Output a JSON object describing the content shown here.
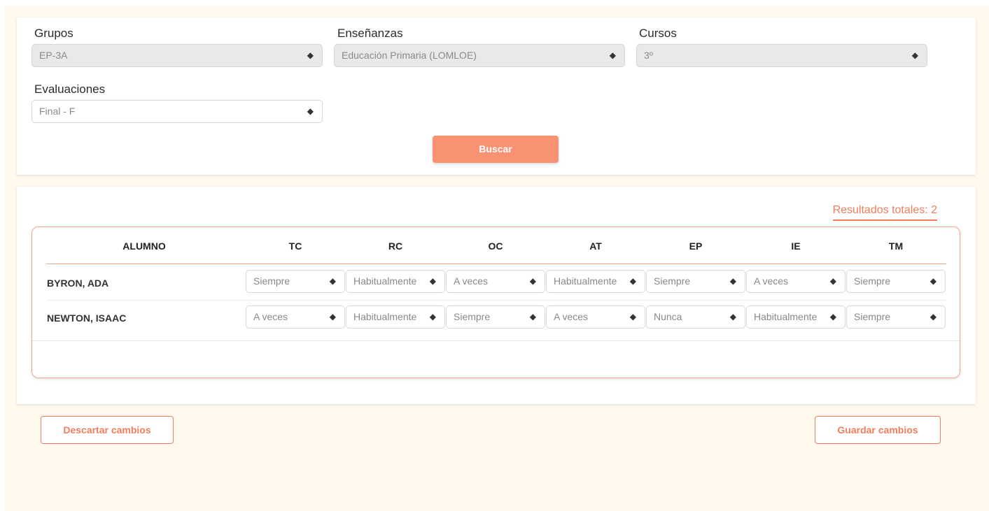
{
  "filters": {
    "grupos": {
      "label": "Grupos",
      "value": "EP-3A"
    },
    "ensenanzas": {
      "label": "Enseñanzas",
      "value": "Educación Primaria (LOMLOE)"
    },
    "cursos": {
      "label": "Cursos",
      "value": "3º"
    },
    "evaluaciones": {
      "label": "Evaluaciones",
      "value": "Final - F"
    },
    "search_label": "Buscar"
  },
  "results": {
    "total_label": "Resultados totales: 2",
    "columns": [
      "ALUMNO",
      "TC",
      "RC",
      "OC",
      "AT",
      "EP",
      "IE",
      "TM"
    ],
    "rows": [
      {
        "name": "BYRON, ADA",
        "values": [
          "Siempre",
          "Habitualmente",
          "A veces",
          "Habitualmente",
          "Siempre",
          "A veces",
          "Siempre"
        ]
      },
      {
        "name": "NEWTON, ISAAC",
        "values": [
          "A veces",
          "Habitualmente",
          "Siempre",
          "A veces",
          "Nunca",
          "Habitualmente",
          "Siempre"
        ]
      }
    ]
  },
  "actions": {
    "discard_label": "Descartar cambios",
    "save_label": "Guardar cambios"
  },
  "icons": {
    "select_caret": "sort-caret-icon"
  },
  "colors": {
    "accent": "#f99272",
    "accent_text": "#f27d5c",
    "background": "#fff9ee"
  }
}
